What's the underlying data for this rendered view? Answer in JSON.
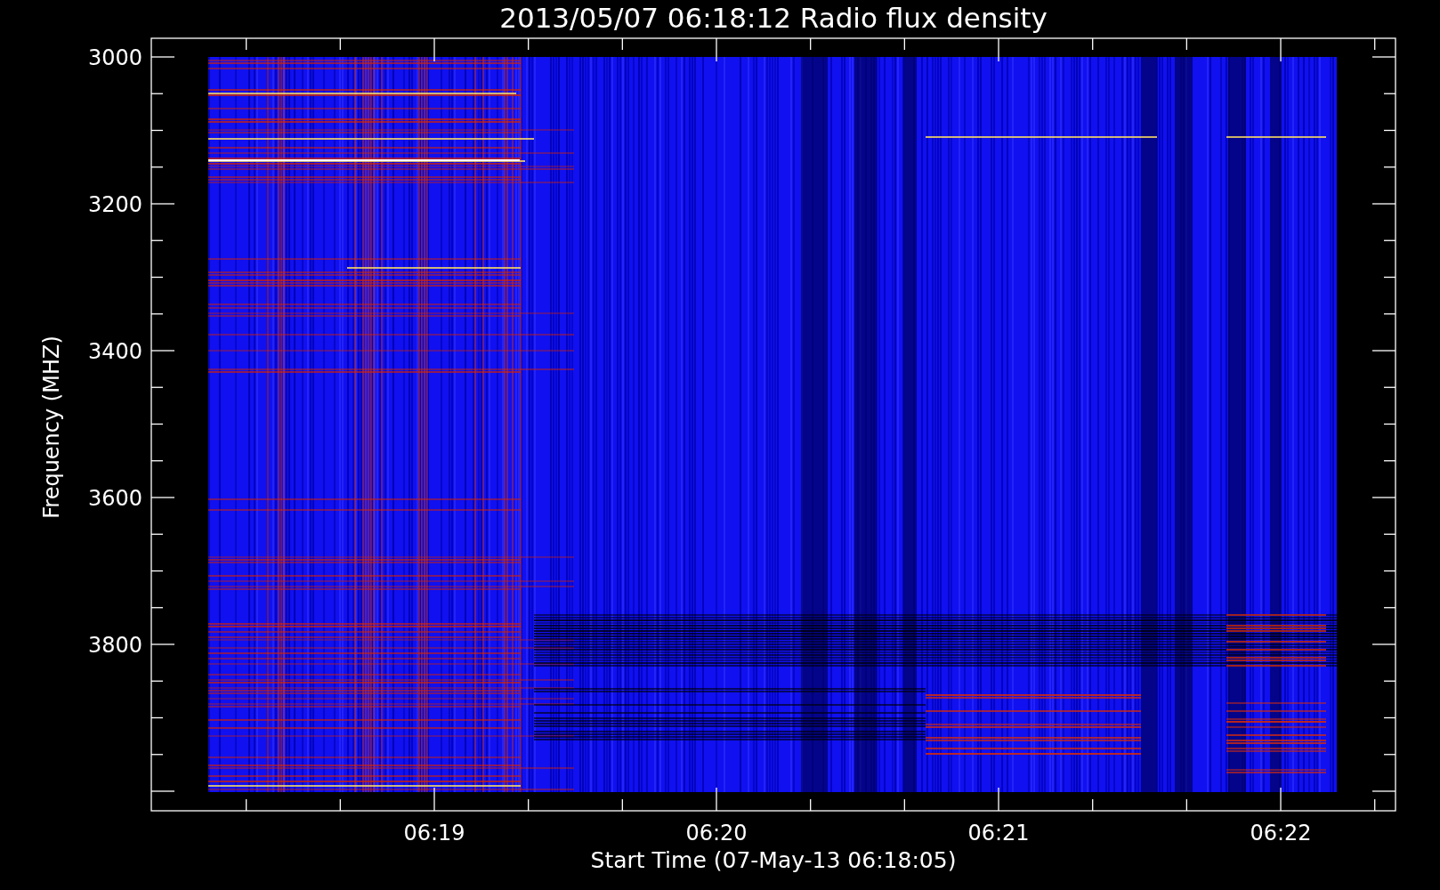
{
  "title": "2013/05/07 06:18:12 Radio flux density",
  "y_axis": {
    "label": "Frequency (MHZ)",
    "ticks": [
      "3000",
      "3200",
      "3400",
      "3600",
      "3800"
    ]
  },
  "x_axis": {
    "label": "Start Time (07-May-13 06:18:05)",
    "ticks": [
      "06:19",
      "06:20",
      "06:21",
      "06:22"
    ]
  }
}
